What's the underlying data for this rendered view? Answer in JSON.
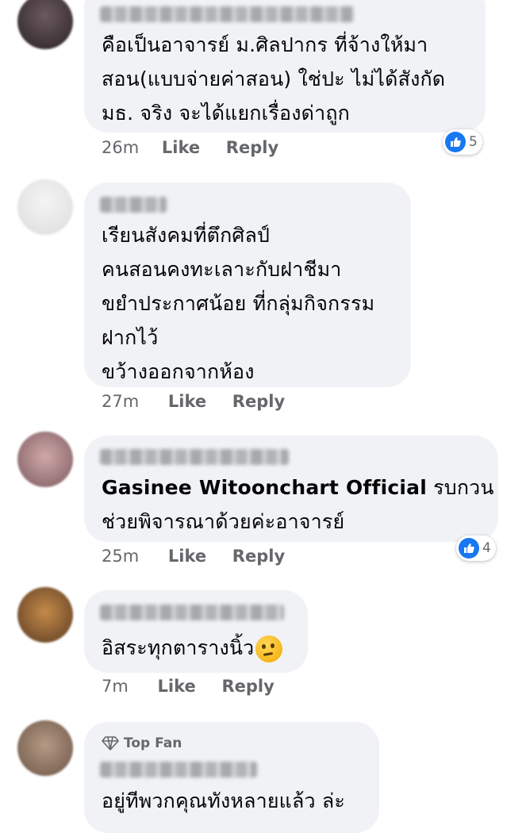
{
  "comments": [
    {
      "lines": [
        "คือเป็นอาจารย์ ม.ศิลปากร ที่จ้างให้มา",
        "สอน(แบบจ่ายค่าสอน) ใช่ปะ ไม่ได้สังกัด",
        "มธ. จริง จะได้แยกเรื่องด่าถูก"
      ],
      "time": "26m",
      "like": "Like",
      "reply": "Reply",
      "reactions": "5"
    },
    {
      "lines": [
        "เรียนสังคมที่ตึกศิลป์",
        "คนสอนคงทะเลาะกับฝาชีมา",
        "ขยำประกาศน้อย ที่กลุ่มกิจกรรม",
        "ฝากไว้",
        "ขว้างออกจากห้อง"
      ],
      "time": "27m",
      "like": "Like",
      "reply": "Reply"
    },
    {
      "mention": "Gasinee Witoonchart Official",
      "line1_rest": " รบกวน",
      "lines": [
        "ช่วยพิจารณาด้วยค่ะอาจารย์"
      ],
      "time": "25m",
      "like": "Like",
      "reply": "Reply",
      "reactions": "4"
    },
    {
      "lines": [
        "อิสระทุกตารางนิ้ว"
      ],
      "emoji": "thinking-face",
      "time": "7m",
      "like": "Like",
      "reply": "Reply"
    },
    {
      "badge": "Top Fan",
      "lines": [
        "อยู่ทีพวกคุณทังหลายแล้ว ล่ะ"
      ]
    }
  ],
  "colors": {
    "bubble": "#f0f2f5",
    "meta": "#65676b",
    "like_blue": "#1877f2"
  }
}
